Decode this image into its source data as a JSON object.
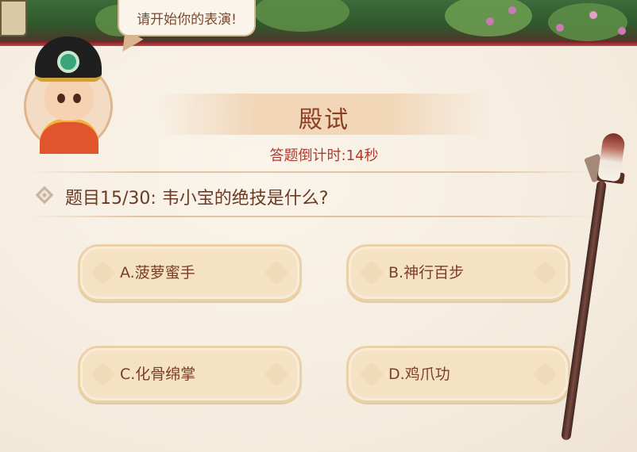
{
  "speech_bubble": {
    "text": "请开始你的表演!"
  },
  "header": {
    "title": "殿试",
    "countdown": "答题倒计时:14秒"
  },
  "question": {
    "text": "题目15/30:  韦小宝的绝技是什么?"
  },
  "answers": [
    {
      "label": "A.菠萝蜜手"
    },
    {
      "label": "B.神行百步"
    },
    {
      "label": "C.化骨绵掌"
    },
    {
      "label": "D.鸡爪功"
    }
  ],
  "colors": {
    "title": "#8a3f22",
    "countdown": "#b03a2e",
    "answer_bg": "#f5e2c4",
    "panel_bg": "#f6efe4"
  }
}
